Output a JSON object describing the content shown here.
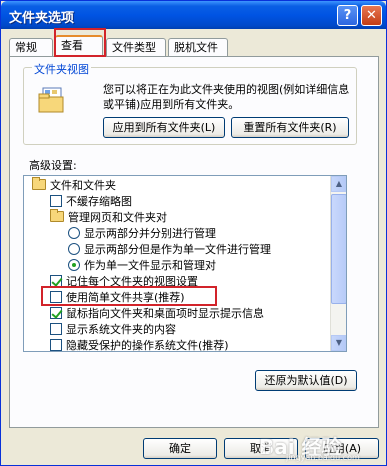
{
  "window": {
    "title": "文件夹选项",
    "help_glyph": "?",
    "close_glyph": "✕"
  },
  "tabs": [
    {
      "label": "常规"
    },
    {
      "label": "查看"
    },
    {
      "label": "文件类型"
    },
    {
      "label": "脱机文件"
    }
  ],
  "folder_views": {
    "legend": "文件夹视图",
    "description": "您可以将正在为此文件夹使用的视图(例如详细信息或平铺)应用到所有文件夹。",
    "apply_all_label": "应用到所有文件夹(L)",
    "reset_all_label": "重置所有文件夹(R)"
  },
  "advanced": {
    "label": "高级设置:",
    "items": [
      {
        "kind": "folder",
        "text": "文件和文件夹"
      },
      {
        "kind": "checkbox",
        "checked": false,
        "text": "不缓存缩略图"
      },
      {
        "kind": "folder",
        "text": "管理网页和文件夹对"
      },
      {
        "kind": "radio",
        "checked": false,
        "text": "显示两部分并分别进行管理"
      },
      {
        "kind": "radio",
        "checked": false,
        "text": "显示两部分但是作为单一文件进行管理"
      },
      {
        "kind": "radio",
        "checked": true,
        "text": "作为单一文件显示和管理对"
      },
      {
        "kind": "checkbox",
        "checked": true,
        "text": "记住每个文件夹的视图设置"
      },
      {
        "kind": "checkbox",
        "checked": false,
        "text": "使用简单文件共享(推荐)"
      },
      {
        "kind": "checkbox",
        "checked": true,
        "text": "鼠标指向文件夹和桌面项时显示提示信息"
      },
      {
        "kind": "checkbox",
        "checked": false,
        "text": "显示系统文件夹的内容"
      },
      {
        "kind": "checkbox",
        "checked": false,
        "text": "隐藏受保护的操作系统文件(推荐)"
      }
    ],
    "restore_defaults_label": "还原为默认值(D)"
  },
  "footer": {
    "ok_label": "确定",
    "cancel_label": "取消",
    "apply_label": "应用(A)"
  },
  "watermark": {
    "text": "Bai 经验",
    "sub": "jingyan.baidu.com"
  },
  "colors": {
    "title_bar": "#0054e3",
    "highlight_box": "#d2232a",
    "legend_text": "#0046d5"
  }
}
